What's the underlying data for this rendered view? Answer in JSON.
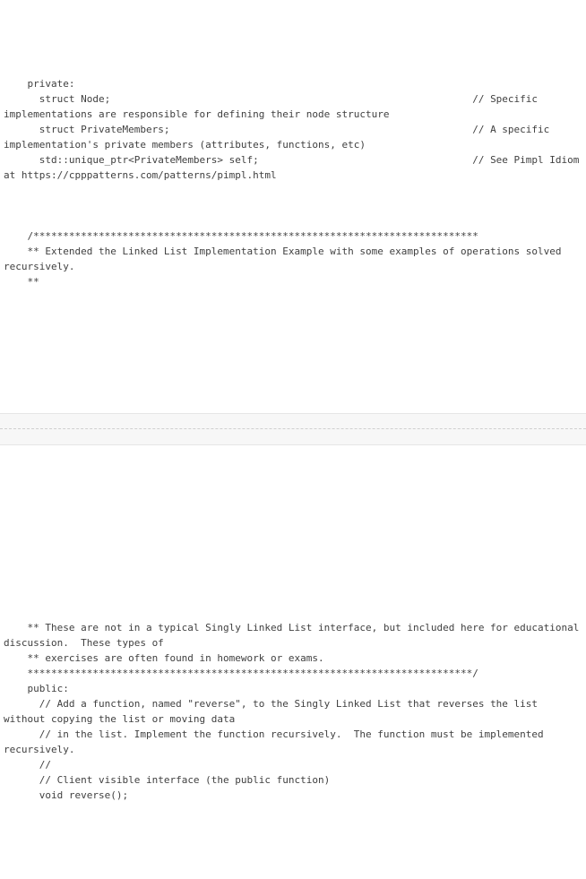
{
  "block1": {
    "l1": "    private:",
    "l2": "      struct Node;                                                             // Specific implementations are responsible for defining their node structure",
    "l3": "      struct PrivateMembers;                                                   // A specific implementation's private members (attributes, functions, etc)",
    "l4": "      std::unique_ptr<PrivateMembers> self;                                    // See Pimpl Idiom at https://cpppatterns.com/patterns/pimpl.html",
    "l5": "",
    "l6": "",
    "l7": "",
    "l8": "    /***************************************************************************",
    "l9": "    ** Extended the Linked List Implementation Example with some examples of operations solved recursively.",
    "l10": "    **"
  },
  "block2": {
    "l1": "    ** These are not in a typical Singly Linked List interface, but included here for educational discussion.  These types of",
    "l2": "    ** exercises are often found in homework or exams.",
    "l3": "    ***************************************************************************/",
    "l4": "    public:",
    "l5": "      // Add a function, named \"reverse\", to the Singly Linked List that reverses the list without copying the list or moving data",
    "l6": "      // in the list. Implement the function recursively.  The function must be implemented recursively.",
    "l7": "      //",
    "l8": "      // Client visible interface (the public function)",
    "l9": "      void reverse();"
  }
}
